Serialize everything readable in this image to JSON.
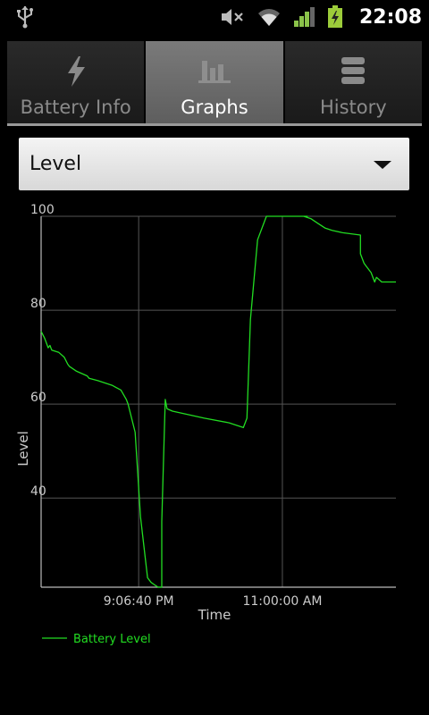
{
  "status_bar": {
    "time": "22:08",
    "icons": [
      "usb-icon",
      "mute-icon",
      "wifi-icon",
      "signal-icon",
      "battery-charging-icon"
    ]
  },
  "tabs": [
    {
      "label": "Battery Info",
      "icon": "lightning-icon",
      "selected": false
    },
    {
      "label": "Graphs",
      "icon": "bar-chart-icon",
      "selected": true
    },
    {
      "label": "History",
      "icon": "stacked-list-icon",
      "selected": false
    }
  ],
  "spinner": {
    "selected": "Level"
  },
  "colors": {
    "series": "#22dd22",
    "grid": "#555555",
    "axis_text": "#cccccc"
  },
  "chart_data": {
    "type": "line",
    "title": "",
    "xlabel": "Time",
    "ylabel": "Level",
    "ylim": [
      21,
      100
    ],
    "yticks": [
      100,
      80,
      60,
      40
    ],
    "xticks": [
      "9:06:40 PM",
      "11:00:00 AM"
    ],
    "legend": "bottom-left",
    "grid": true,
    "series": [
      {
        "name": "Battery Level",
        "x": [
          0.0,
          0.01,
          0.02,
          0.025,
          0.03,
          0.05,
          0.065,
          0.075,
          0.08,
          0.1,
          0.13,
          0.135,
          0.16,
          0.2,
          0.225,
          0.24,
          0.245,
          0.265,
          0.28,
          0.3,
          0.31,
          0.32,
          0.33,
          0.34,
          0.34,
          0.35,
          0.355,
          0.37,
          0.4,
          0.46,
          0.53,
          0.57,
          0.58,
          0.59,
          0.61,
          0.635,
          0.67,
          0.7,
          0.75,
          0.74,
          0.76,
          0.78,
          0.8,
          0.82,
          0.85,
          0.9,
          0.9,
          0.91,
          0.915,
          0.93,
          0.94,
          0.945,
          0.96,
          1.0
        ],
        "y": [
          75.5,
          74,
          72,
          72.5,
          71.5,
          71,
          70,
          68.5,
          68,
          67,
          66,
          65.5,
          65,
          64,
          63,
          61,
          60,
          54,
          36,
          23,
          22,
          21.5,
          21,
          21,
          35,
          61,
          59,
          58.5,
          58,
          57,
          56,
          55,
          57,
          78,
          95,
          100,
          100,
          100,
          100,
          100,
          99.5,
          98.5,
          97.5,
          97,
          96.5,
          96,
          92,
          90,
          89.5,
          88,
          86,
          87,
          86,
          86
        ]
      }
    ]
  }
}
